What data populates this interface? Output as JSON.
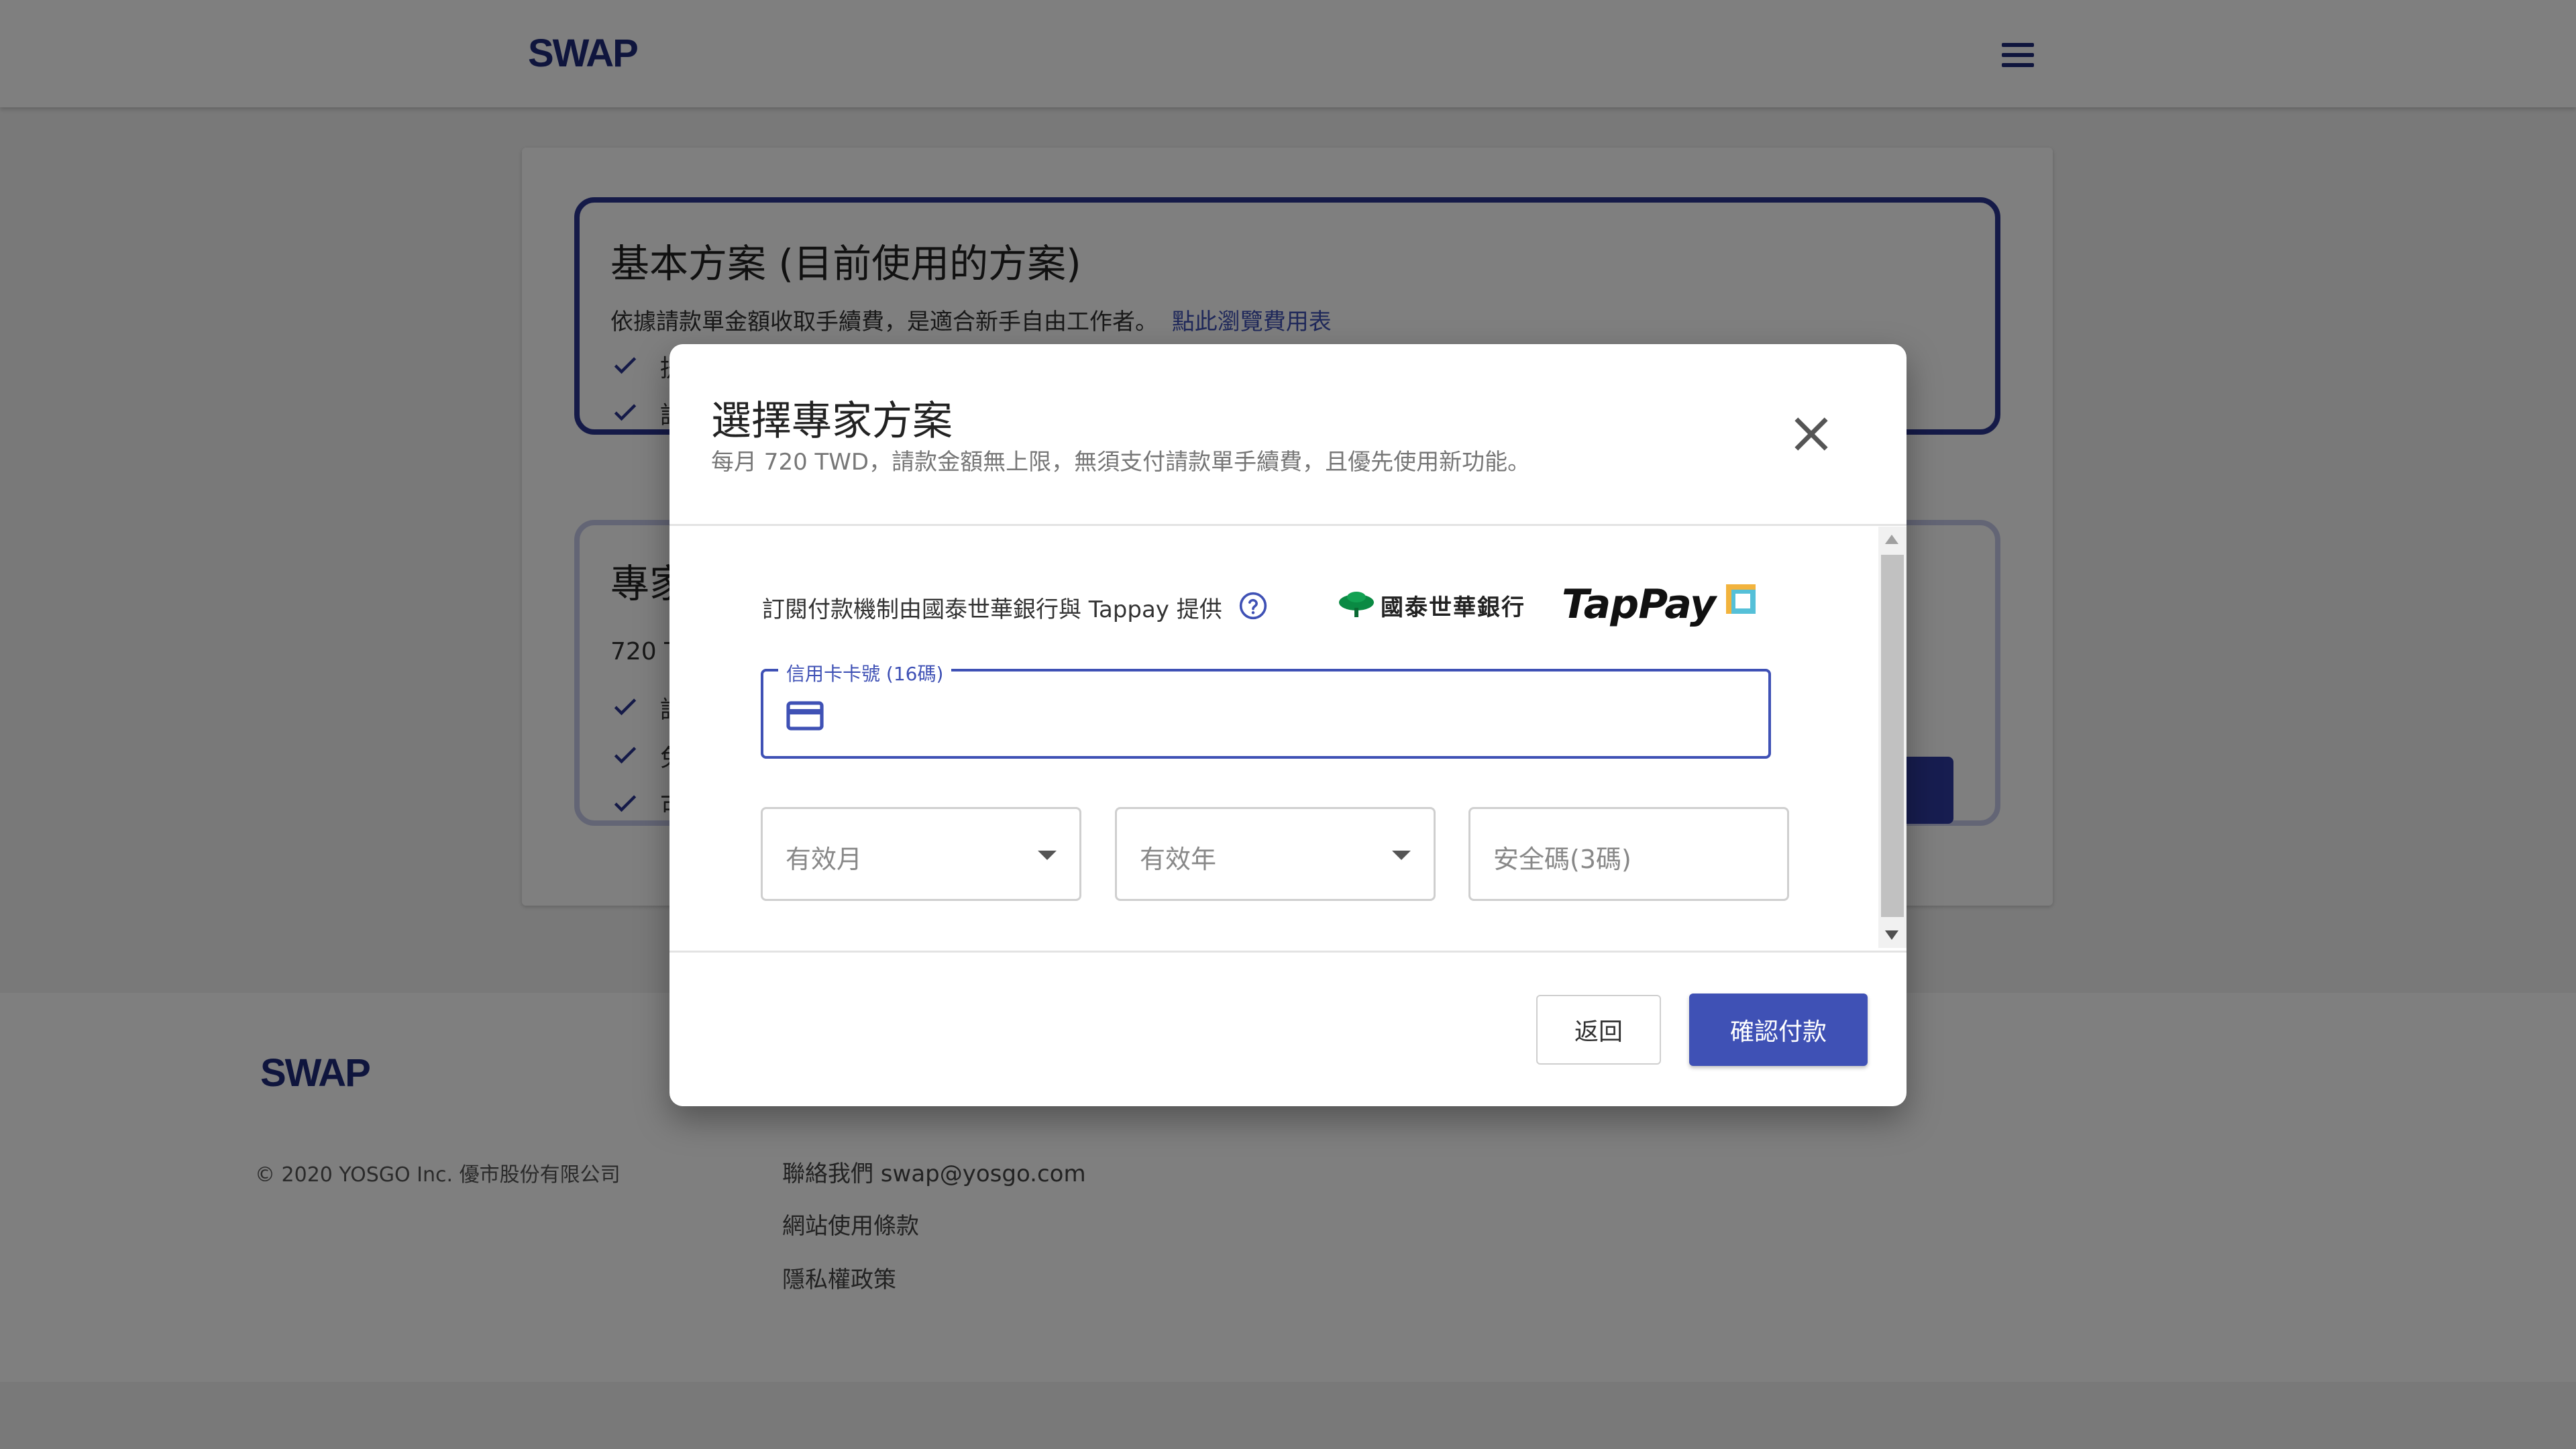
{
  "header": {
    "logo_text": "SWAP",
    "menu_icon": "hamburger-menu-icon"
  },
  "plans": {
    "basic": {
      "title": "基本方案 (目前使用的方案)",
      "description": "依據請款單金額收取手續費，是適合新手自由工作者。",
      "link_text": "點此瀏覽費用表",
      "features": [
        "提",
        "請"
      ]
    },
    "pro": {
      "title": "專家",
      "price": "720 T",
      "features": [
        "請",
        "免",
        "可"
      ]
    }
  },
  "dialog": {
    "title": "選擇專家方案",
    "subtitle": "每月 720 TWD，請款金額無上限，無須支付請款單手續費，且優先使用新功能。",
    "provider_text": "訂閱付款機制由國泰世華銀行與 Tappay 提供",
    "bank_name": "國泰世華銀行",
    "tappay_name": "TapPay",
    "card_number_label": "信用卡卡號 (16碼)",
    "card_number_value": "",
    "expiry_month_placeholder": "有效月",
    "expiry_year_placeholder": "有效年",
    "cvc_placeholder": "安全碼(3碼)",
    "back_label": "返回",
    "confirm_label": "確認付款"
  },
  "footer": {
    "logo_text": "SWAP",
    "copyright": "© 2020 YOSGO Inc. 優市股份有限公司",
    "links": [
      "聯絡我們 swap@yosgo.com",
      "網站使用條款",
      "隱私權政策"
    ]
  },
  "colors": {
    "brand_navy": "#1f2a7a",
    "primary": "#3f51b5",
    "overlay": "rgba(0,0,0,0.5)"
  }
}
